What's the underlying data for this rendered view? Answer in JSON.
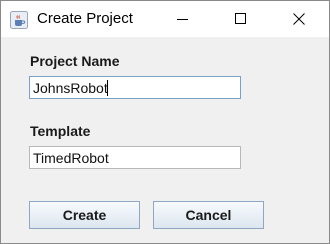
{
  "window": {
    "title": "Create Project",
    "icon": "java-coffee-cup-icon"
  },
  "titlebar_controls": [
    "minimize-icon",
    "maximize-icon",
    "close-icon"
  ],
  "form": {
    "project_name_label": "Project Name",
    "project_name_value": "JohnsRobot",
    "template_label": "Template",
    "template_value": "TimedRobot"
  },
  "buttons": {
    "create_label": "Create",
    "cancel_label": "Cancel"
  },
  "colors": {
    "window_bg": "#f0f0f0",
    "titlebar_bg": "#ffffff",
    "focused_border": "#7aa0c8",
    "button_border": "#8fa7c2"
  }
}
